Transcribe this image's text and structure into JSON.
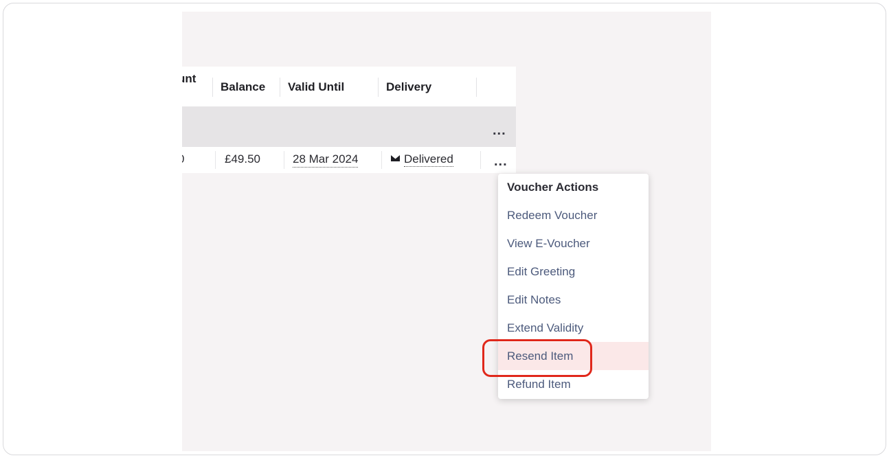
{
  "table": {
    "headers": {
      "amount_partial": "unt",
      "balance": "Balance",
      "valid_until": "Valid Until",
      "delivery": "Delivery"
    },
    "group_row": {
      "actions_label": "..."
    },
    "row": {
      "amount_partial": "0",
      "balance": "£49.50",
      "valid_until": "28 Mar 2024",
      "delivery_status": "Delivered",
      "actions_label": "..."
    }
  },
  "menu": {
    "title": "Voucher Actions",
    "items": [
      {
        "label": "Redeem Voucher"
      },
      {
        "label": "View E-Voucher"
      },
      {
        "label": "Edit Greeting"
      },
      {
        "label": "Edit Notes"
      },
      {
        "label": "Extend Validity"
      },
      {
        "label": "Resend Item",
        "highlighted": true
      },
      {
        "label": "Refund Item"
      }
    ]
  },
  "colors": {
    "viewport_bg": "#f6f3f4",
    "group_row_bg": "#e6e4e6",
    "menu_item_text": "#4c5a7c",
    "highlight_bg": "#fbe8e8",
    "annotation_border": "#e0281b"
  },
  "icons": {
    "delivery": "envelope-icon",
    "row_actions": "more-options-icon"
  }
}
